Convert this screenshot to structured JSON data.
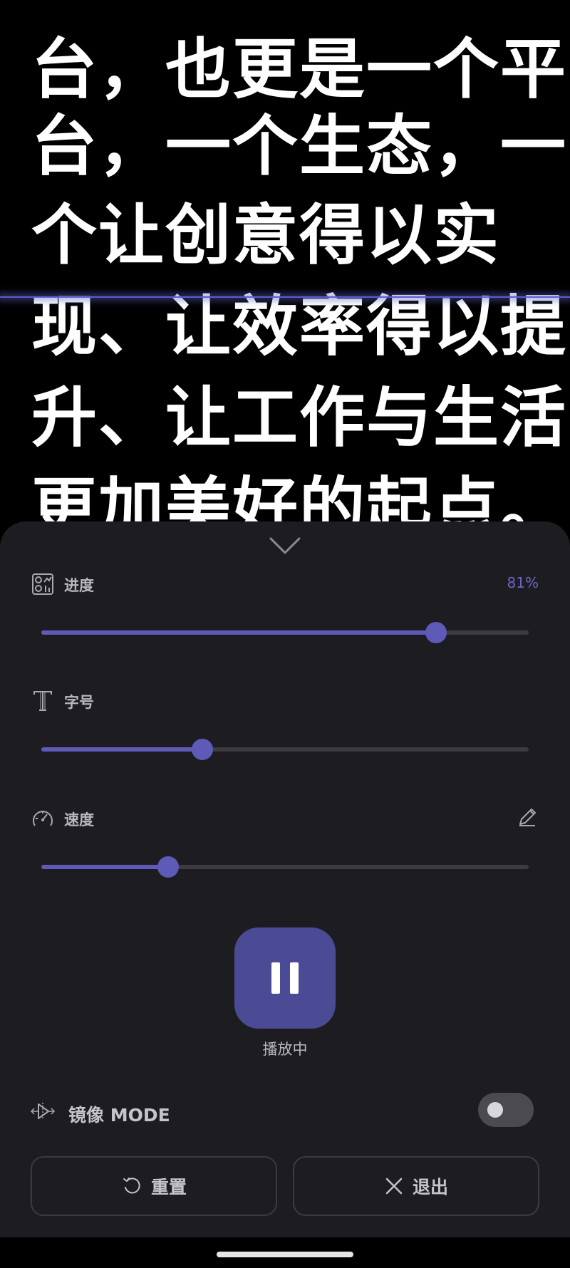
{
  "teleprompter": {
    "lines": [
      "台，也更是一个平",
      "台，一个生态，一",
      "个让创意得以实",
      "现、让效率得以提",
      "升、让工作与生活",
      "更加美好的起点。"
    ]
  },
  "panel": {
    "progress": {
      "label": "进度",
      "value_text": "81%",
      "value": 0.81,
      "icon": "progress-dashboard-icon"
    },
    "font_size": {
      "label": "字号",
      "value": 0.33,
      "icon": "text-size-icon"
    },
    "speed": {
      "label": "速度",
      "value": 0.26,
      "icon": "speedometer-icon",
      "edit_icon": "pencil-icon"
    },
    "playback": {
      "status": "播放中",
      "state_icon": "pause-icon"
    },
    "mirror": {
      "label": "镜像 MODE",
      "enabled": false,
      "icon": "mirror-flip-icon"
    },
    "buttons": {
      "reset": "重置",
      "exit": "退出"
    }
  },
  "colors": {
    "accent": "#5d5ab8",
    "panel_bg": "#1d1d21",
    "play_button": "#4b4a94"
  }
}
